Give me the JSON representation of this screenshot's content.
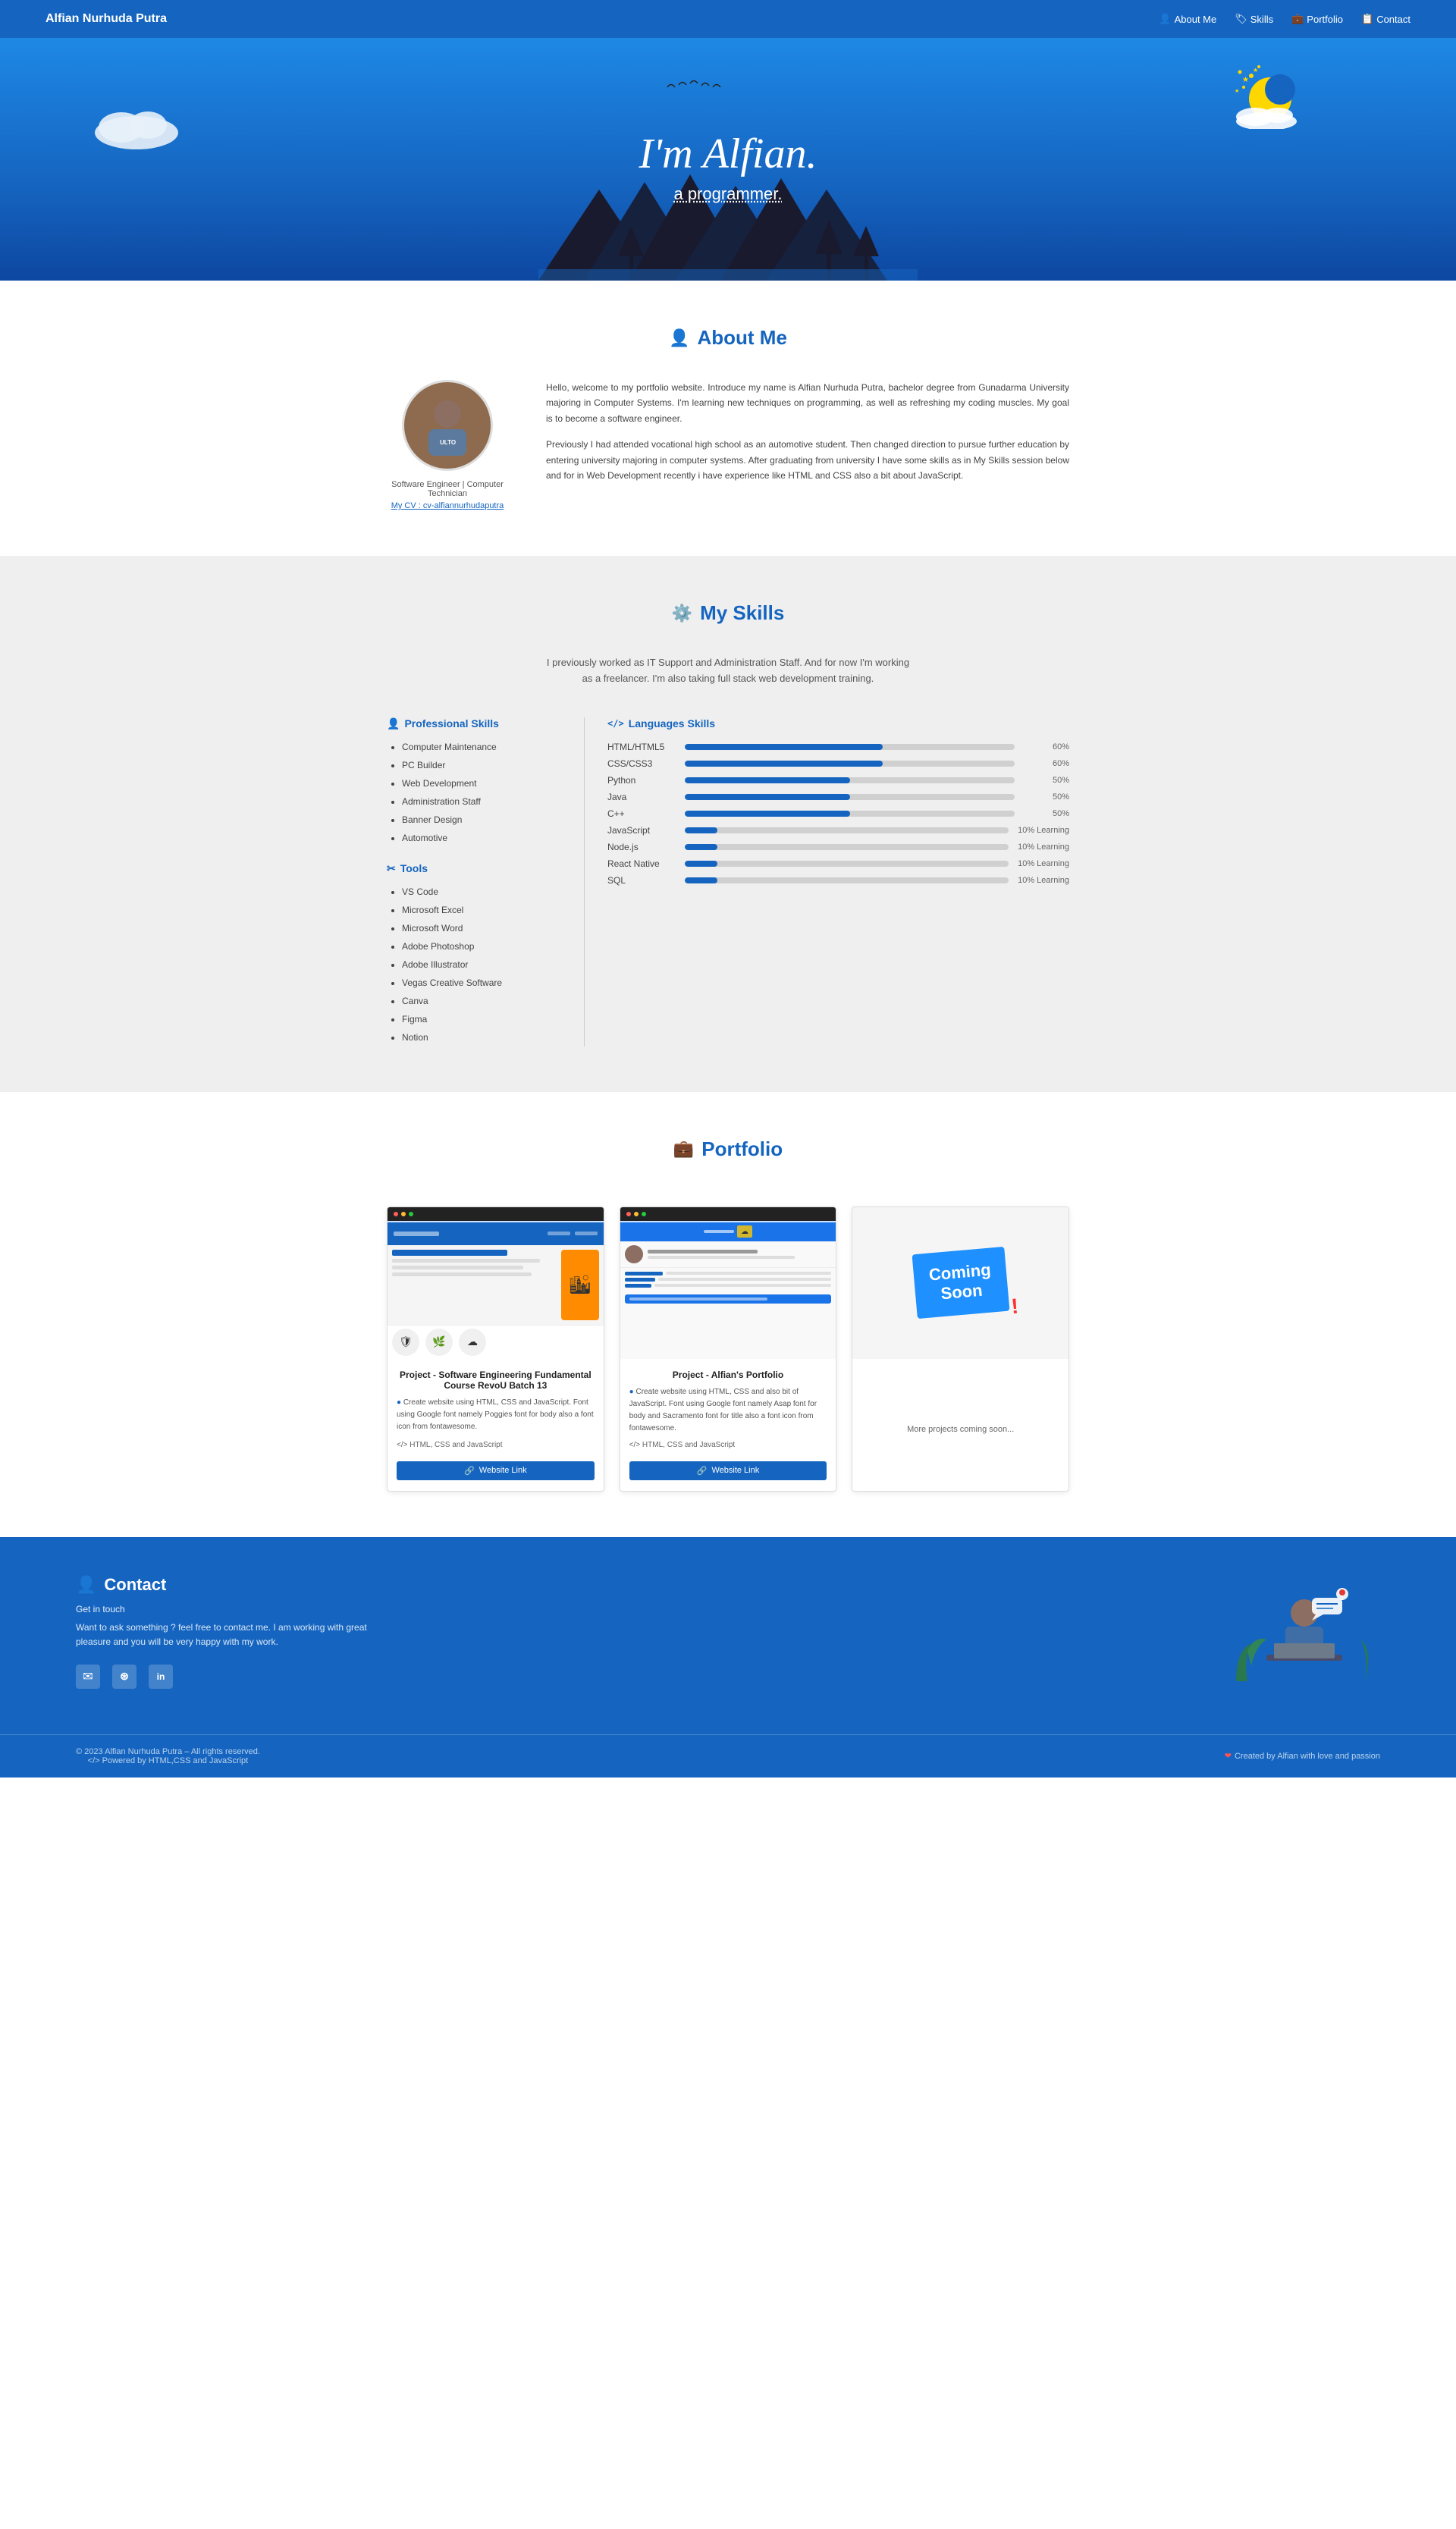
{
  "navbar": {
    "brand": "Alfian Nurhuda Putra",
    "links": [
      {
        "label": "About Me",
        "href": "#about",
        "icon": "person"
      },
      {
        "label": "Skills",
        "href": "#skills",
        "icon": "skills"
      },
      {
        "label": "Portfolio",
        "href": "#portfolio",
        "icon": "portfolio"
      },
      {
        "label": "Contact",
        "href": "#contact",
        "icon": "contact"
      }
    ]
  },
  "hero": {
    "title": "I'm Alfian.",
    "subtitle_prefix": "a ",
    "subtitle_highlight": "pro",
    "subtitle_rest": "grammer."
  },
  "about": {
    "section_title": "About Me",
    "role": "Software Engineer | Computer Technician",
    "cv_label": "My CV : cv-alfiannurhudaputra",
    "para1": "Hello, welcome to my portfolio website. Introduce my name is Alfian Nurhuda Putra, bachelor degree from Gunadarma University majoring in Computer Systems. I'm learning new techniques on programming, as well as refreshing my coding muscles. My goal is to become a software engineer.",
    "para2": "Previously I had attended vocational high school as an automotive student. Then changed direction to pursue further education by entering university majoring in computer systems. After graduating from university I have some skills as in My Skills session below and for in Web Development recently i have experience like HTML and CSS also a bit about JavaScript."
  },
  "skills": {
    "section_title": "My Skills",
    "intro_line1": "I previously worked as IT Support and Administration Staff. And for now I'm working",
    "intro_line2": "as a freelancer. I'm also taking full stack web development training.",
    "professional": {
      "title": "Professional Skills",
      "items": [
        "Computer Maintenance",
        "PC Builder",
        "Web Development",
        "Administration Staff",
        "Banner Design",
        "Automotive"
      ]
    },
    "tools": {
      "title": "Tools",
      "items": [
        "VS Code",
        "Microsoft Excel",
        "Microsoft Word",
        "Adobe Photoshop",
        "Adobe Illustrator",
        "Vegas Creative Software",
        "Canva",
        "Figma",
        "Notion"
      ]
    },
    "languages": {
      "title": "Languages Skills",
      "items": [
        {
          "name": "HTML/HTML5",
          "pct": 60,
          "label": "60%"
        },
        {
          "name": "CSS/CSS3",
          "pct": 60,
          "label": "60%"
        },
        {
          "name": "Python",
          "pct": 50,
          "label": "50%"
        },
        {
          "name": "Java",
          "pct": 50,
          "label": "50%"
        },
        {
          "name": "C++",
          "pct": 50,
          "label": "50%"
        },
        {
          "name": "JavaScript",
          "pct": 10,
          "label": "10% Learning"
        },
        {
          "name": "Node.js",
          "pct": 10,
          "label": "10% Learning"
        },
        {
          "name": "React Native",
          "pct": 10,
          "label": "10% Learning"
        },
        {
          "name": "SQL",
          "pct": 10,
          "label": "10% Learning"
        }
      ]
    }
  },
  "portfolio": {
    "section_title": "Portfolio",
    "projects": [
      {
        "title": "Project - Software Engineering Fundamental Course RevoU Batch 13",
        "desc": "Create website using HTML, CSS and JavaScript. Font using Google font namely Poggies font for body also a font icon from fontawesome.",
        "tech": "HTML, CSS and JavaScript",
        "btn_label": "Website Link",
        "type": "project1"
      },
      {
        "title": "Project - Alfian's Portfolio",
        "desc": "Create website using HTML, CSS and also bit of JavaScript. Font using Google font namely Asap font for body and Sacramento font for title also a font icon from fontawesome.",
        "tech": "HTML, CSS and JavaScript",
        "btn_label": "Website Link",
        "type": "project2"
      },
      {
        "title": "More projects coming soon...",
        "type": "coming_soon"
      }
    ]
  },
  "contact": {
    "section_title": "Contact",
    "get_in_touch": "Get in touch",
    "desc": "Want to ask something ? feel free to contact me. I am working with great pleasure and you will be very happy with my work.",
    "icons": [
      {
        "name": "email",
        "symbol": "✉"
      },
      {
        "name": "github",
        "symbol": "⑆"
      },
      {
        "name": "linkedin",
        "symbol": "in"
      }
    ]
  },
  "footer": {
    "copyright": "© 2023 Alfian Nurhuda Putra – All rights reserved.",
    "powered": "Powered by HTML,CSS and JavaScript",
    "credit": "Created by Alfian with love and passion"
  }
}
